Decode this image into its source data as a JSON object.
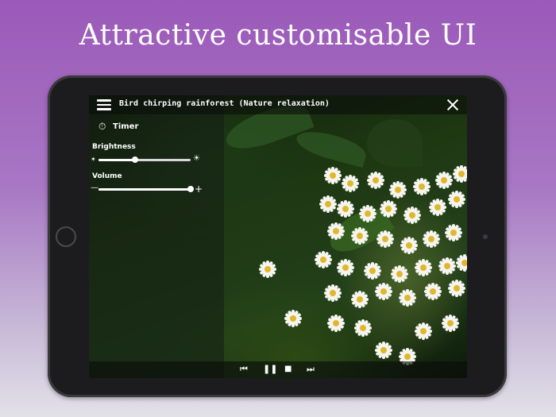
{
  "promo": {
    "headline": "Attractive customisable UI"
  },
  "player": {
    "title": "Bird chirping rainforest (Nature relaxation)",
    "menu_icon": "hamburger-menu-icon",
    "close_icon": "close-icon"
  },
  "settings": {
    "timer_label": "Timer",
    "timer_icon": "stopwatch-icon",
    "brightness_label": "Brightness",
    "brightness_level": 0.4,
    "brightness_min_icon": "sun-small-icon",
    "brightness_max_icon": "sun-large-icon",
    "volume_label": "Volume",
    "volume_level": 1.0,
    "volume_min_icon": "minus-icon",
    "volume_max_icon": "plus-icon"
  },
  "controls": {
    "rewind_icon": "rewind-icon",
    "pause_icon": "pause-icon",
    "stop_icon": "stop-icon",
    "forward_icon": "fast-forward-icon"
  }
}
